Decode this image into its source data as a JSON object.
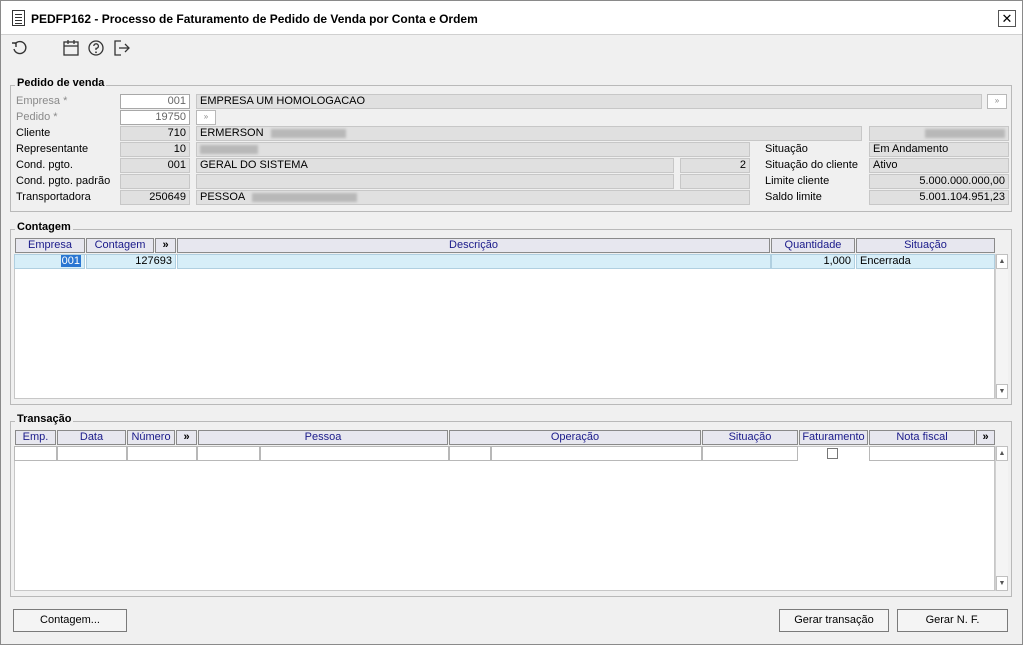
{
  "window": {
    "title": "PEDFP162 - Processo de Faturamento de Pedido de Venda por Conta e Ordem"
  },
  "toolbar": {
    "icons": [
      "refresh-icon",
      "calendar-icon",
      "help-icon",
      "exit-icon"
    ]
  },
  "pedido": {
    "section_title": "Pedido de venda",
    "empresa_label": "Empresa *",
    "empresa_code": "001",
    "empresa_name": "EMPRESA UM HOMOLOGACAO",
    "pedido_label": "Pedido *",
    "pedido_value": "19750",
    "cliente_label": "Cliente",
    "cliente_code": "710",
    "cliente_name": "ERMERSON",
    "representante_label": "Representante",
    "representante_code": "10",
    "cond_label": "Cond. pgto.",
    "cond_code": "001",
    "cond_name": "GERAL DO SISTEMA",
    "cond_extra": "2",
    "cond_padrao_label": "Cond. pgto. padrão",
    "transp_label": "Transportadora",
    "transp_code": "250649",
    "transp_name": "PESSOA",
    "situacao_label": "Situação",
    "situacao_value": "Em Andamento",
    "sit_cliente_label": "Situação do cliente",
    "sit_cliente_value": "Ativo",
    "limite_label": "Limite cliente",
    "limite_value": "5.000.000.000,00",
    "saldo_label": "Saldo limite",
    "saldo_value": "5.001.104.951,23"
  },
  "contagem": {
    "section_title": "Contagem",
    "columns": [
      "Empresa",
      "Contagem",
      "»",
      "Descrição",
      "Quantidade",
      "Situação"
    ],
    "rows": [
      {
        "empresa": "001",
        "contagem": "127693",
        "descricao": "",
        "quantidade": "1,000",
        "situacao": "Encerrada"
      }
    ]
  },
  "transacao": {
    "section_title": "Transação",
    "columns": [
      "Emp.",
      "Data",
      "Número",
      "»",
      "Pessoa",
      "Operação",
      "Situação",
      "Faturamento",
      "Nota fiscal",
      "»"
    ]
  },
  "buttons": {
    "contagem": "Contagem...",
    "gerar_transacao": "Gerar transação",
    "gerar_nf": "Gerar N. F."
  }
}
